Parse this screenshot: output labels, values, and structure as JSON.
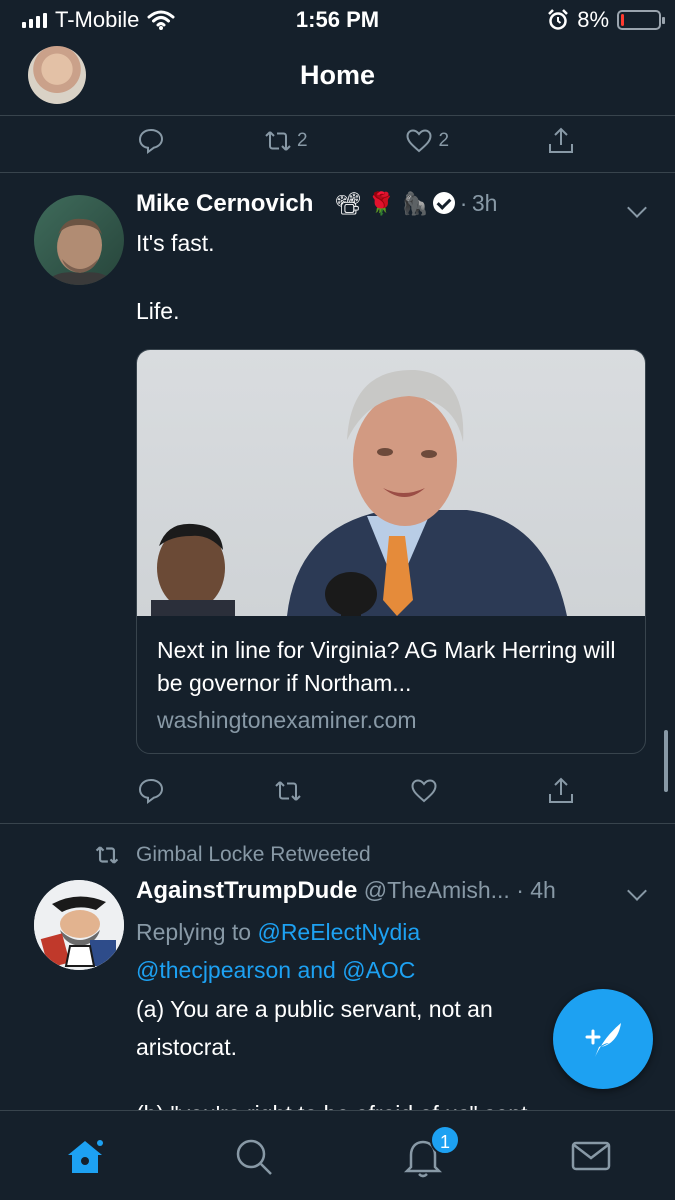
{
  "status_bar": {
    "carrier": "T-Mobile",
    "time": "1:56 PM",
    "battery": "8%",
    "battery_level": 0.08,
    "icons": [
      "signal-icon",
      "wifi-icon",
      "alarm-icon",
      "battery-icon"
    ]
  },
  "header": {
    "title": "Home"
  },
  "prev_tweet": {
    "retweet_count": "2",
    "like_count": "2"
  },
  "tweet1": {
    "author_name": "Mike Cernovich",
    "emojis": "📽 🌹 🦍",
    "time": "3h",
    "text_line1": "It's fast.",
    "text_line2": "Life.",
    "card_title": "Next in line for Virginia? AG Mark Herring will be governor if Northam...",
    "card_domain": "washingtonexaminer.com"
  },
  "tweet2": {
    "retweeted_by": "Gimbal Locke Retweeted",
    "author_name": "AgainstTrumpDude",
    "handle": "@TheAmish...",
    "time": "4h",
    "replying_label": "Replying to",
    "reply_handle1": "@ReElectNydia",
    "reply_handle2": "@thecjpearson",
    "and_label": "and",
    "reply_handle3": "@AOC",
    "text_line1": "(a) You are a public servant, not an",
    "text_line2": "aristocrat.",
    "text_line3": "(b) \"you're right to be afraid of us\" sent"
  },
  "tabbar": {
    "items": [
      "home-icon",
      "search-icon",
      "notifications-icon",
      "messages-icon"
    ],
    "notification_badge": "1"
  },
  "colors": {
    "background": "#15202b",
    "accent": "#1da1f2",
    "muted": "#8899a6",
    "divider": "#38444d"
  }
}
